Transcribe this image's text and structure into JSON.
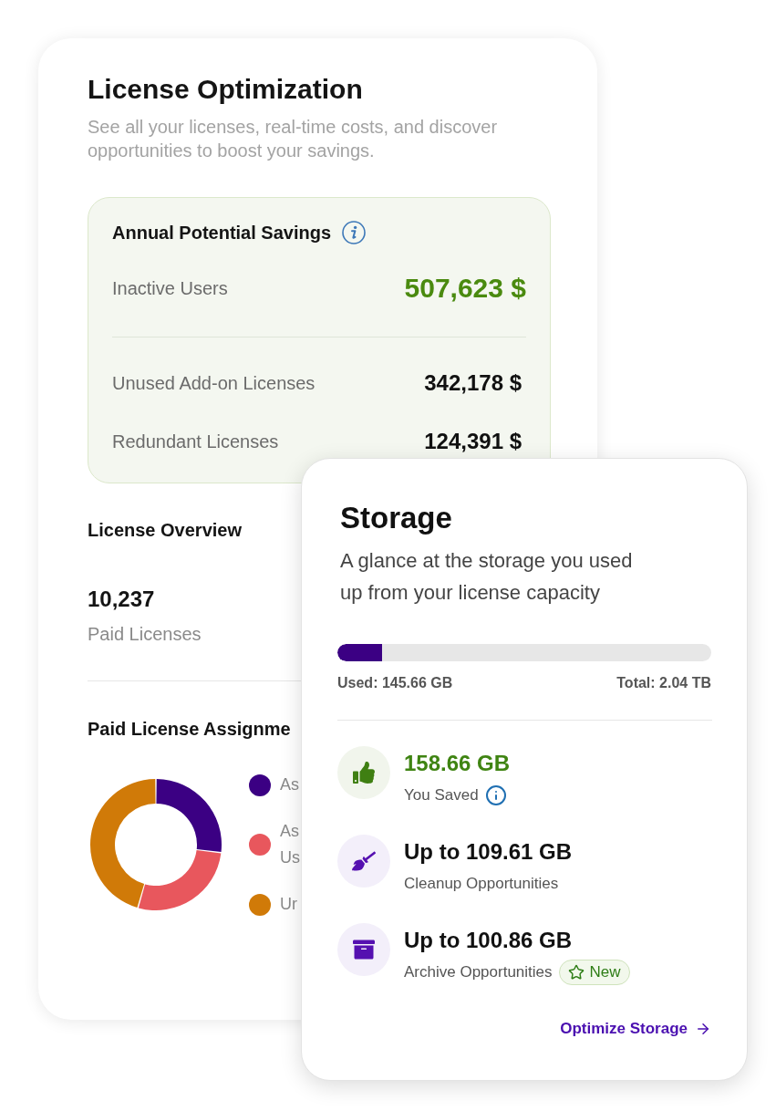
{
  "license_card": {
    "title": "License Optimization",
    "subtitle": "See all your licenses, real-time costs, and discover opportunities to boost your savings.",
    "savings": {
      "title": "Annual Potential Savings",
      "items": [
        {
          "kind": "primary",
          "label": "Inactive Users",
          "value": "507,623 $"
        },
        {
          "kind": "secondary",
          "label": "Unused Add-on Licenses",
          "value": "342,178 $"
        },
        {
          "kind": "secondary",
          "label": "Redundant Licenses",
          "value": "124,391 $"
        }
      ]
    },
    "overview": {
      "title": "License Overview",
      "value": "10,237",
      "label": "Paid Licenses"
    },
    "assignment": {
      "title": "Paid License Assignme",
      "legend": [
        {
          "label": "As",
          "color": "#3b0083"
        },
        {
          "label": "As Us",
          "color": "#e8575d"
        },
        {
          "label": "Ur",
          "color": "#d07a08"
        }
      ]
    }
  },
  "storage_card": {
    "title": "Storage",
    "description": "A glance at the storage you used up from your license capacity",
    "usage": {
      "level": 0.12,
      "used": "Used: 145.66 GB",
      "total": "Total: 2.04 TB"
    },
    "rows": [
      {
        "kind": "saved",
        "value": "158.66 GB",
        "label": "You Saved",
        "info": true
      },
      {
        "kind": "opportunity",
        "value": "Up to 109.61 GB",
        "label": "Cleanup Opportunities",
        "info": false
      },
      {
        "kind": "opportunity",
        "value": "Up to 100.86 GB",
        "label": "Archive Opportunities",
        "info": false,
        "badge": "New"
      }
    ],
    "link": "Optimize Storage"
  }
}
